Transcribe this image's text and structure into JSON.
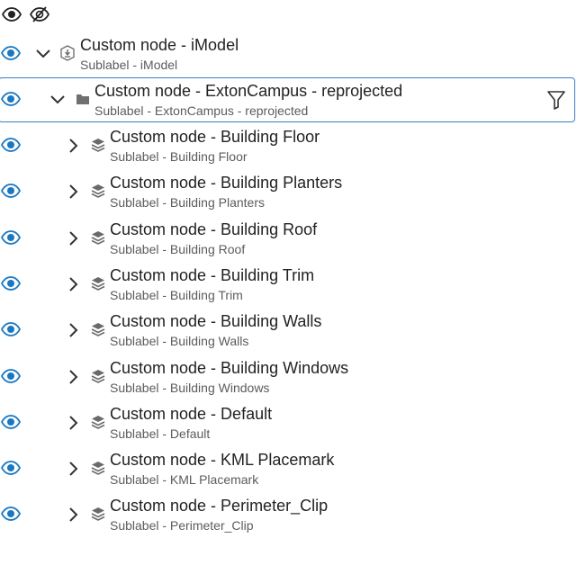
{
  "toolbar": {
    "show_all_icon": "eye-icon",
    "hide_all_icon": "eye-slash-icon"
  },
  "colors": {
    "accent": "#1a78c2",
    "selected_border": "#3b7fc4",
    "label": "#222222",
    "sublabel": "#5c5c5c"
  },
  "tree": {
    "root": {
      "label": "Custom node - iModel",
      "sublabel": "Sublabel - iModel",
      "icon": "imodel-icon",
      "expanded": true
    },
    "subject": {
      "label": "Custom node - ExtonCampus - reprojected",
      "sublabel": "Sublabel - ExtonCampus - reprojected",
      "icon": "folder-icon",
      "expanded": true,
      "selected": true,
      "action_icon": "filter-icon"
    },
    "items": [
      {
        "label": "Custom node - Building Floor",
        "sublabel": "Sublabel - Building Floor"
      },
      {
        "label": "Custom node - Building Planters",
        "sublabel": "Sublabel - Building Planters"
      },
      {
        "label": "Custom node - Building Roof",
        "sublabel": "Sublabel - Building Roof"
      },
      {
        "label": "Custom node - Building Trim",
        "sublabel": "Sublabel - Building Trim"
      },
      {
        "label": "Custom node - Building Walls",
        "sublabel": "Sublabel - Building Walls"
      },
      {
        "label": "Custom node - Building Windows",
        "sublabel": "Sublabel - Building Windows"
      },
      {
        "label": "Custom node - Default",
        "sublabel": "Sublabel - Default"
      },
      {
        "label": "Custom node - KML Placemark",
        "sublabel": "Sublabel - KML Placemark"
      },
      {
        "label": "Custom node - Perimeter_Clip",
        "sublabel": "Sublabel - Perimeter_Clip"
      }
    ]
  }
}
